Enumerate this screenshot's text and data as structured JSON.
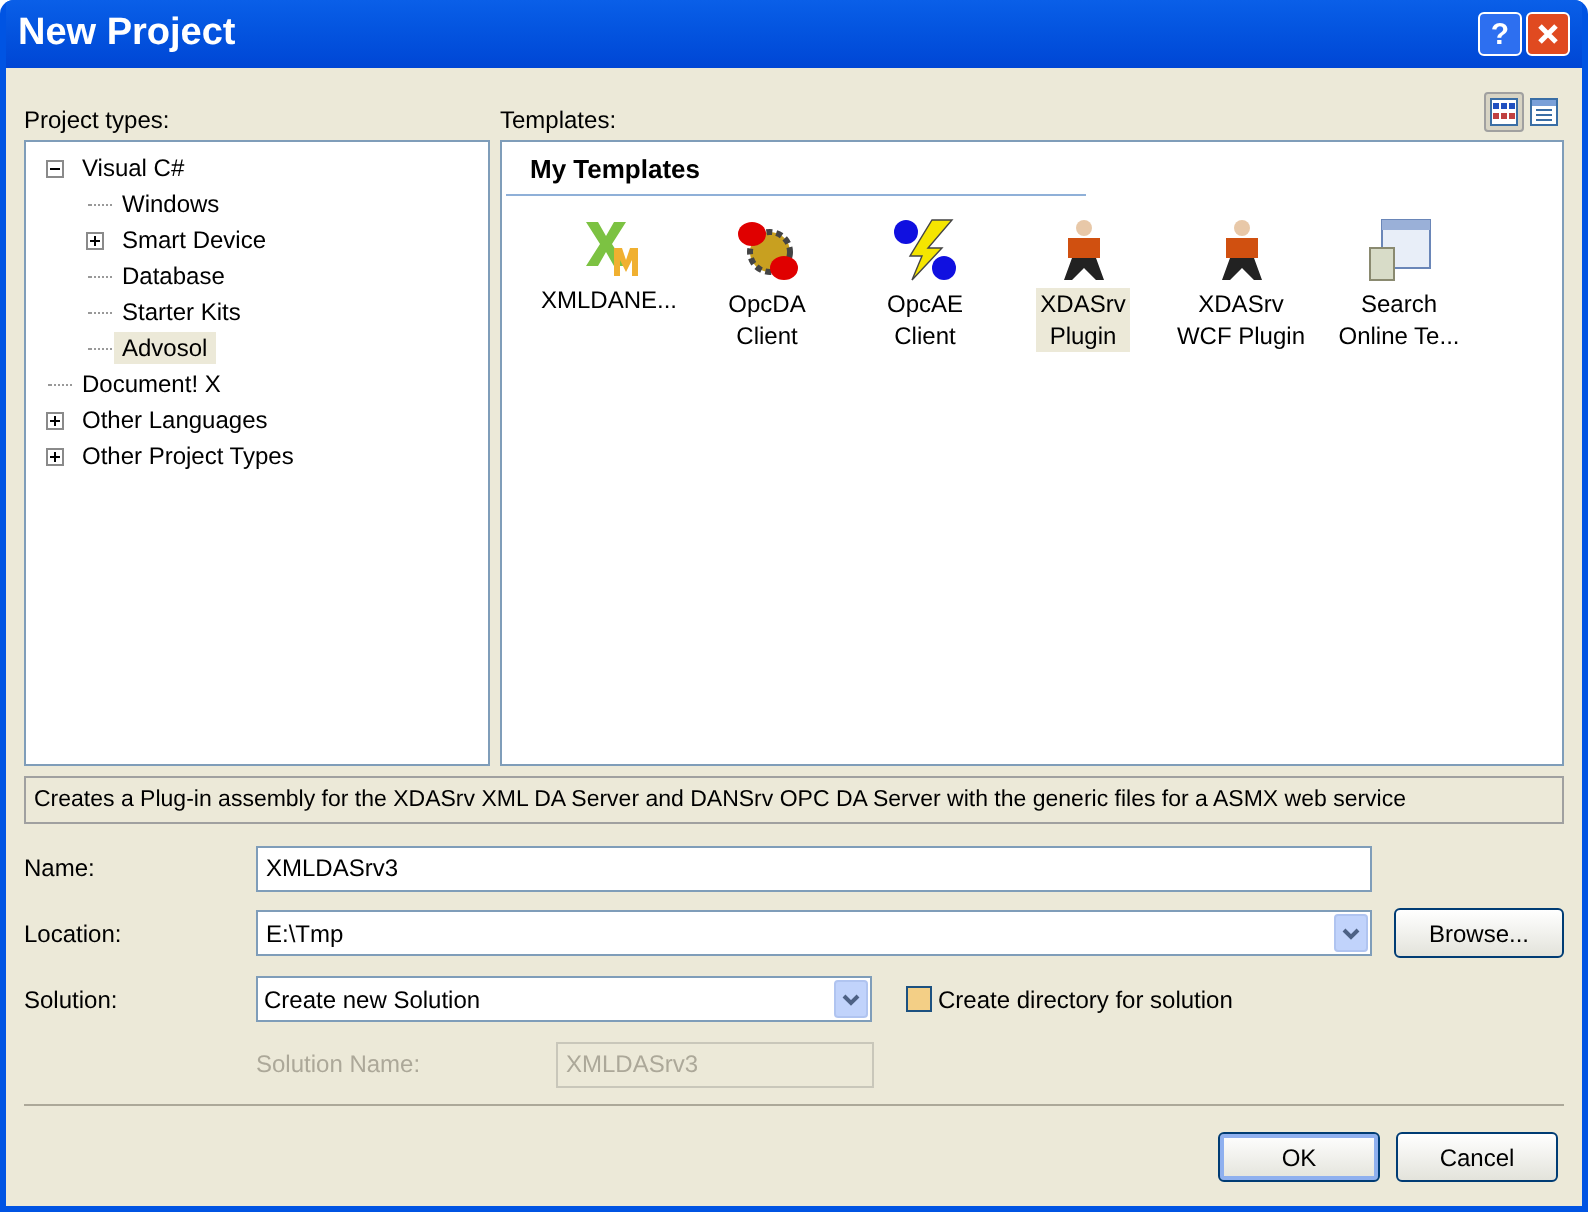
{
  "window": {
    "title": "New Project",
    "help_button": "?"
  },
  "project_types": {
    "label": "Project types:",
    "tree": [
      {
        "label": "Visual C#",
        "expanded": true,
        "selected": false,
        "children": [
          {
            "label": "Windows",
            "selected": false
          },
          {
            "label": "Smart Device",
            "expanded": false,
            "selected": false
          },
          {
            "label": "Database",
            "selected": false
          },
          {
            "label": "Starter Kits",
            "selected": false
          },
          {
            "label": "Advosol",
            "selected": true
          }
        ]
      },
      {
        "label": "Document! X",
        "selected": false
      },
      {
        "label": "Other Languages",
        "expanded": false,
        "selected": false
      },
      {
        "label": "Other Project Types",
        "expanded": false,
        "selected": false
      }
    ]
  },
  "templates": {
    "label": "Templates:",
    "views": [
      {
        "kind": "large",
        "selected": true
      },
      {
        "kind": "small",
        "selected": false
      }
    ],
    "group": "My Templates",
    "items": [
      {
        "kind": "xml",
        "label": "XMLDANE...",
        "selected": false
      },
      {
        "kind": "gear",
        "label": "OpcDA Client",
        "selected": false
      },
      {
        "kind": "bolt",
        "label": "OpcAE Client",
        "selected": false
      },
      {
        "kind": "figure",
        "label": "XDASrv Plugin",
        "selected": true
      },
      {
        "kind": "figure",
        "label": "XDASrv WCF Plugin",
        "selected": false
      },
      {
        "kind": "window",
        "label": "Search Online Te...",
        "selected": false
      }
    ]
  },
  "description": "Creates a Plug-in assembly for the XDASrv XML DA Server and DANSrv OPC DA Server with the generic files for a ASMX web service",
  "form": {
    "name": {
      "label": "Name:",
      "value": "XMLDASrv3"
    },
    "location": {
      "label": "Location:",
      "value": "E:\\Tmp",
      "browse": "Browse..."
    },
    "solution": {
      "label": "Solution:",
      "value": "Create new Solution"
    },
    "create_directory": {
      "label": "Create directory for solution",
      "checked": false
    },
    "solution_name": {
      "label": "Solution Name:",
      "value": "XMLDASrv3",
      "disabled": true
    }
  },
  "buttons": [
    "OK",
    "Cancel"
  ]
}
